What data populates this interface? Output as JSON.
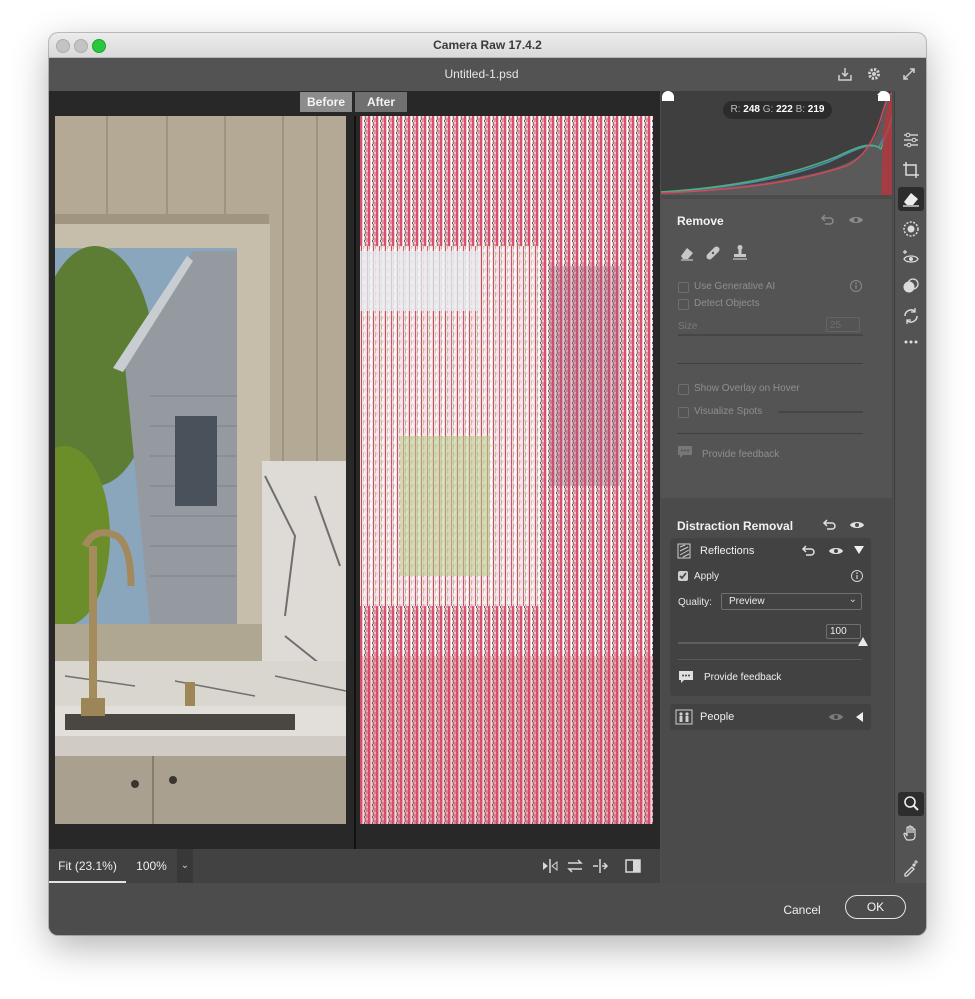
{
  "window": {
    "app_title": "Camera Raw 17.4.2",
    "document_title": "Untitled-1.psd"
  },
  "view": {
    "before_label": "Before",
    "after_label": "After"
  },
  "histogram": {
    "r_label": "R:",
    "r_value": "248",
    "g_label": "G:",
    "g_value": "222",
    "b_label": "B:",
    "b_value": "219"
  },
  "remove": {
    "title": "Remove",
    "use_generative_ai": "Use Generative AI",
    "detect_objects": "Detect Objects",
    "size_label": "Size",
    "size_value": "25",
    "show_overlay": "Show Overlay on Hover",
    "visualize_spots": "Visualize Spots",
    "feedback": "Provide feedback"
  },
  "distraction": {
    "title": "Distraction Removal",
    "reflections": {
      "label": "Reflections",
      "apply_label": "Apply",
      "apply_checked": true,
      "quality_label": "Quality:",
      "quality_value": "Preview",
      "amount_value": "100",
      "amount_fraction": 1.0,
      "feedback": "Provide feedback"
    },
    "people": {
      "label": "People"
    }
  },
  "bottom_bar": {
    "zoom_fit": "Fit (23.1%)",
    "zoom_100": "100%"
  },
  "footer": {
    "cancel": "Cancel",
    "ok": "OK"
  },
  "icons": {
    "header": [
      "save-icon",
      "gear-icon",
      "fullscreen-icon"
    ],
    "tools": [
      "edit-sliders-icon",
      "crop-icon",
      "eraser-icon",
      "masking-icon",
      "redeye-icon",
      "presets-icon",
      "sync-icon",
      "more-icon",
      "zoom-icon",
      "hand-icon",
      "color-sampler-icon",
      "grid-icon"
    ]
  },
  "colors": {
    "panel_bg": "#4b4b4b",
    "accent_white": "#ffffff",
    "before_tab": "#8c8c8c",
    "after_tab": "#707070"
  }
}
